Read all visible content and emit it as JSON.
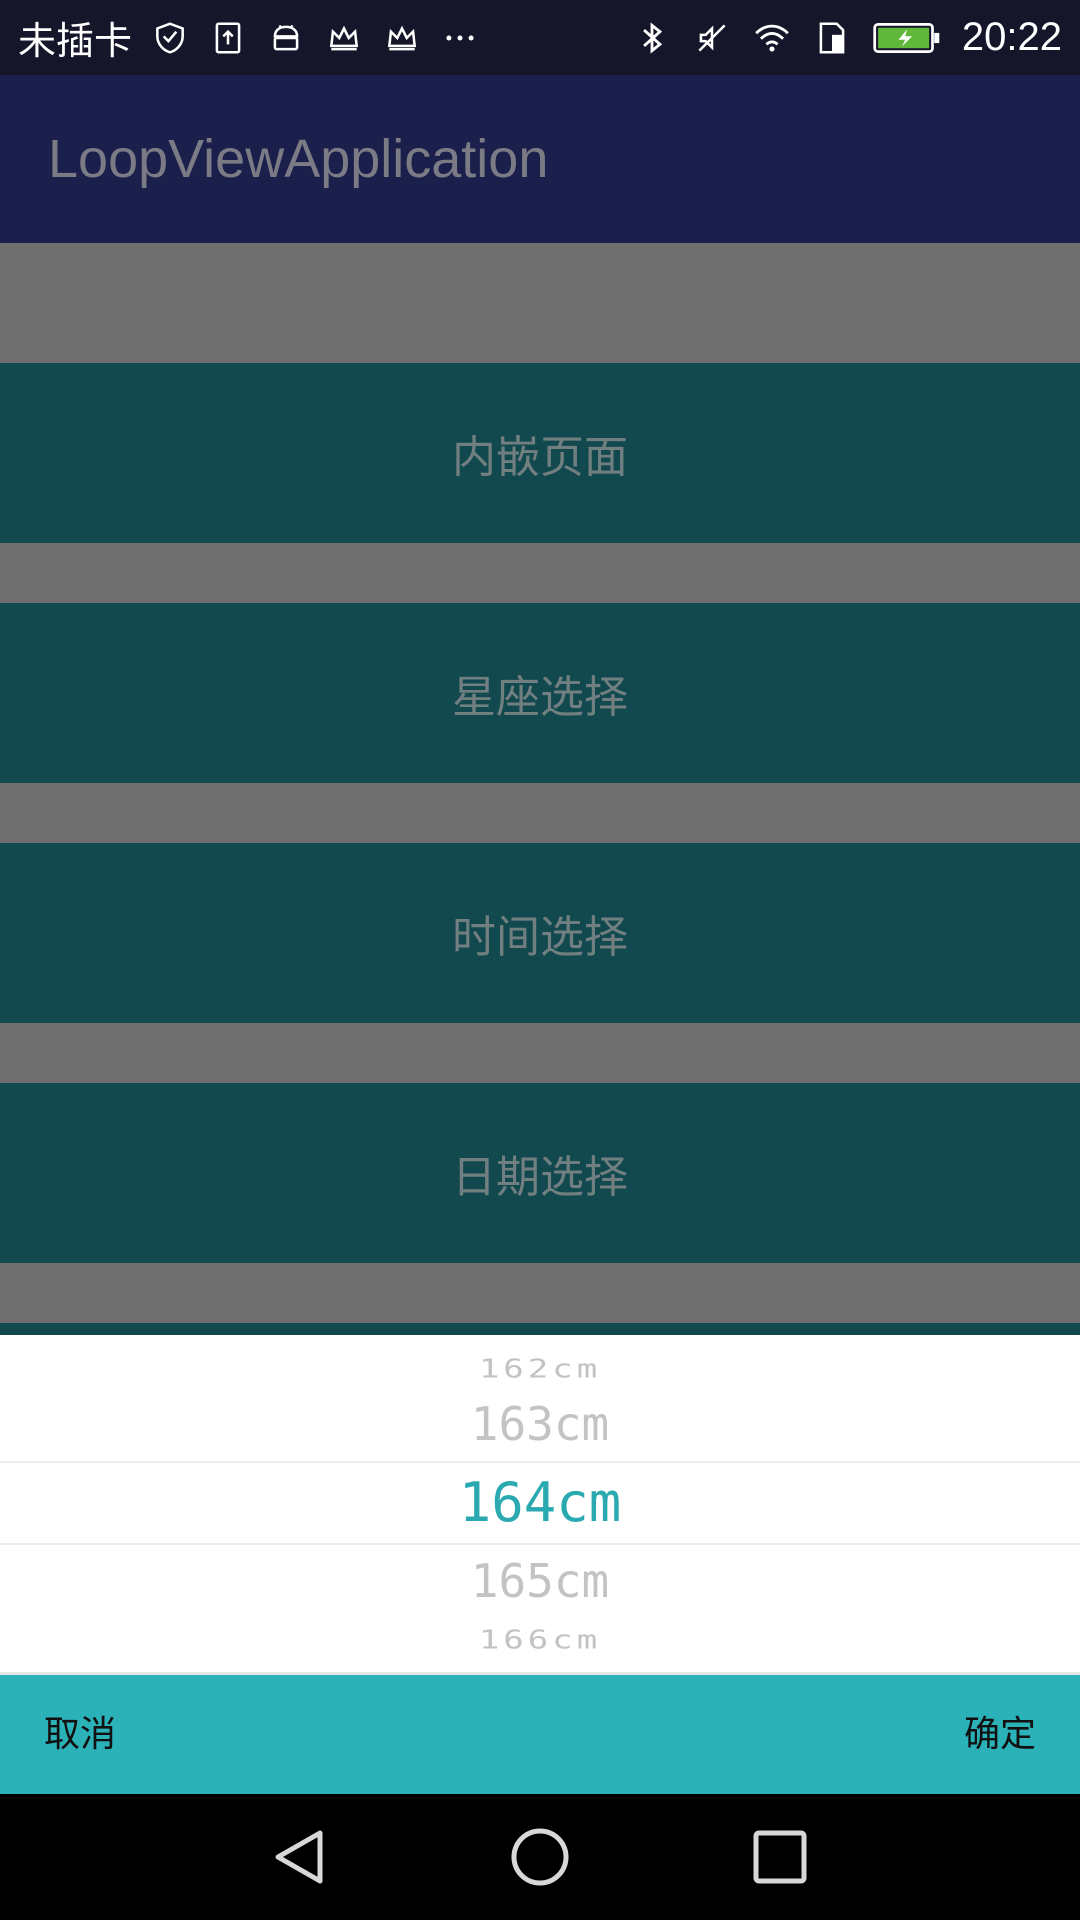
{
  "status_bar": {
    "carrier": "未插卡",
    "time": "20:22",
    "left_icons": [
      "shield-check-icon",
      "upload-icon",
      "android-icon",
      "crown-icon",
      "crown-icon",
      "more-icon"
    ],
    "right_icons": [
      "bluetooth-icon",
      "mute-icon",
      "wifi-icon",
      "sim-icon",
      "battery-icon"
    ]
  },
  "app_bar": {
    "title": "LoopViewApplication"
  },
  "menu": {
    "items": [
      {
        "label": "内嵌页面"
      },
      {
        "label": "星座选择"
      },
      {
        "label": "时间选择"
      },
      {
        "label": "日期选择"
      }
    ]
  },
  "picker": {
    "items": [
      "162cm",
      "163cm",
      "164cm",
      "165cm",
      "166cm"
    ],
    "selected": "164cm"
  },
  "dialog_actions": {
    "cancel": "取消",
    "confirm": "确定"
  },
  "colors": {
    "accent": "#2aa9b1",
    "action_bar": "#2bb1b8",
    "app_bar": "#1b1f4b",
    "menu_item": "#12494f"
  },
  "nav_bar": {
    "icons": [
      "back-icon",
      "home-icon",
      "recents-icon"
    ]
  }
}
